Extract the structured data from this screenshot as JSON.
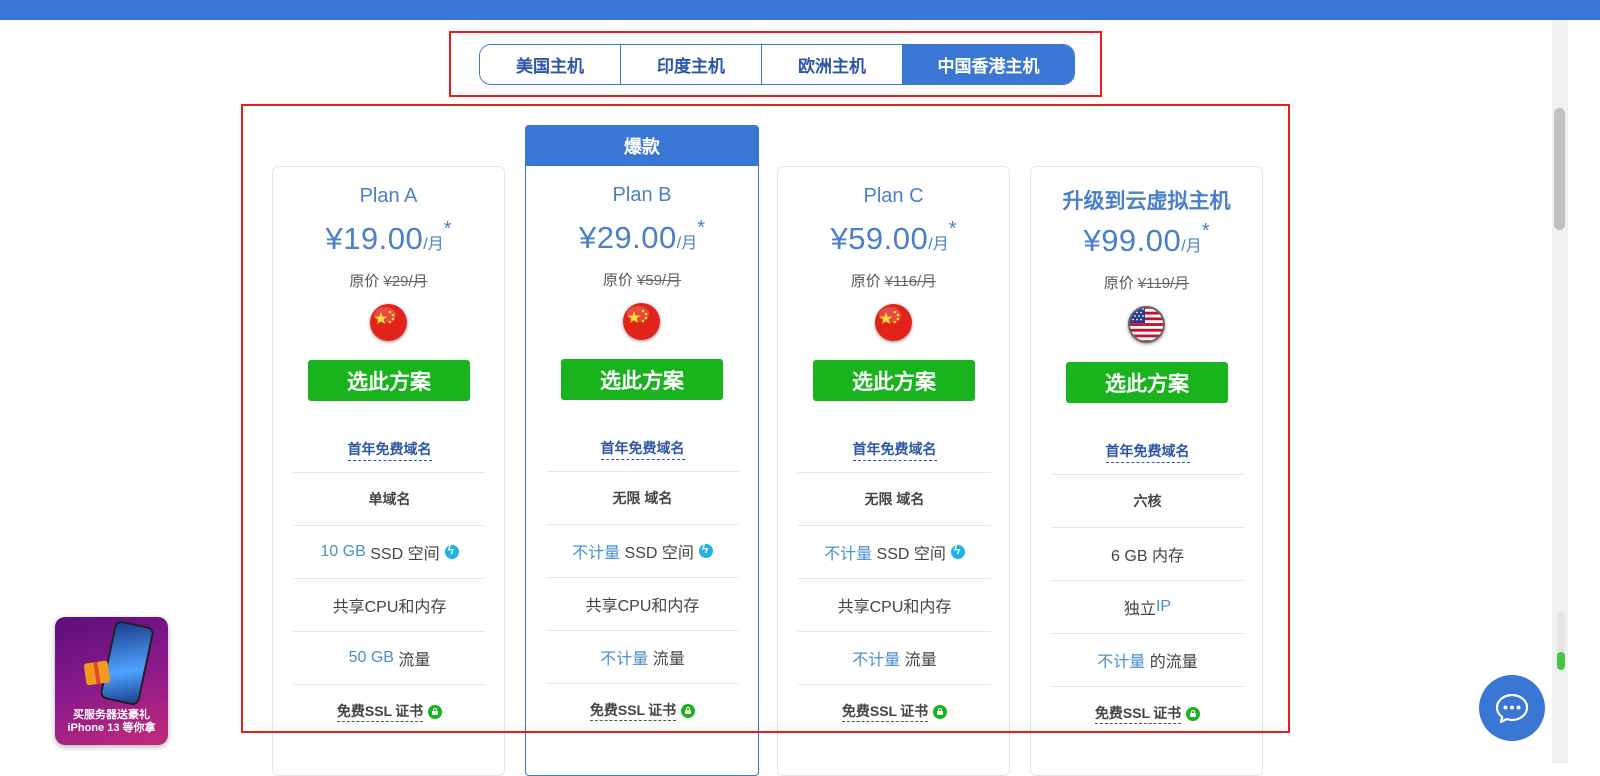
{
  "tabs": [
    {
      "label": "美国主机",
      "active": false
    },
    {
      "label": "印度主机",
      "active": false
    },
    {
      "label": "欧洲主机",
      "active": false
    },
    {
      "label": "中国香港主机",
      "active": true
    }
  ],
  "featured_badge": "爆款",
  "orig_label": "原价",
  "select_label": "选此方案",
  "per_month": "/月",
  "star": "*",
  "plans": [
    {
      "name": "Plan A",
      "price": "¥19.00",
      "orig": "¥29/月",
      "flag": "china-flag-icon",
      "features": {
        "domain": "首年免费域名",
        "domains": "单域名",
        "storage_value": "10 GB",
        "storage_label": "SSD 空间",
        "cpu": "共享CPU和内存",
        "traffic_value": "50 GB",
        "traffic_label": "流量",
        "ssl_free": "免费SSL",
        "ssl_cert": "证书"
      }
    },
    {
      "name": "Plan B",
      "price": "¥29.00",
      "orig": "¥59/月",
      "flag": "china-flag-icon",
      "features": {
        "domain": "首年免费域名",
        "domains": "无限 域名",
        "storage_value": "不计量",
        "storage_label": "SSD 空间",
        "cpu": "共享CPU和内存",
        "traffic_value": "不计量",
        "traffic_label": "流量",
        "ssl_free": "免费SSL",
        "ssl_cert": "证书"
      }
    },
    {
      "name": "Plan C",
      "price": "¥59.00",
      "orig": "¥116/月",
      "flag": "china-flag-icon",
      "features": {
        "domain": "首年免费域名",
        "domains": "无限 域名",
        "storage_value": "不计量",
        "storage_label": "SSD 空间",
        "cpu": "共享CPU和内存",
        "traffic_value": "不计量",
        "traffic_label": "流量",
        "ssl_free": "免费SSL",
        "ssl_cert": "证书"
      }
    },
    {
      "name": "升级到云虚拟主机",
      "price": "¥99.00",
      "orig": "¥119/月",
      "flag": "usa-flag-icon",
      "features": {
        "domain": "首年免费域名",
        "cores": "六核",
        "memory": "6 GB 内存",
        "ip_main": "独立",
        "ip_suffix": "IP",
        "traffic_value": "不计量",
        "traffic_label": "的流量",
        "ssl_free": "免费SSL",
        "ssl_cert": "证书"
      }
    }
  ],
  "promo": {
    "line1": "买服务器送豪礼",
    "line2": "iPhone 13 等你拿"
  },
  "colors": {
    "brand": "#3a76d4",
    "select_button": "#19b31e",
    "highlight": "#4a8fcf",
    "frame": "#ea1d1d"
  }
}
